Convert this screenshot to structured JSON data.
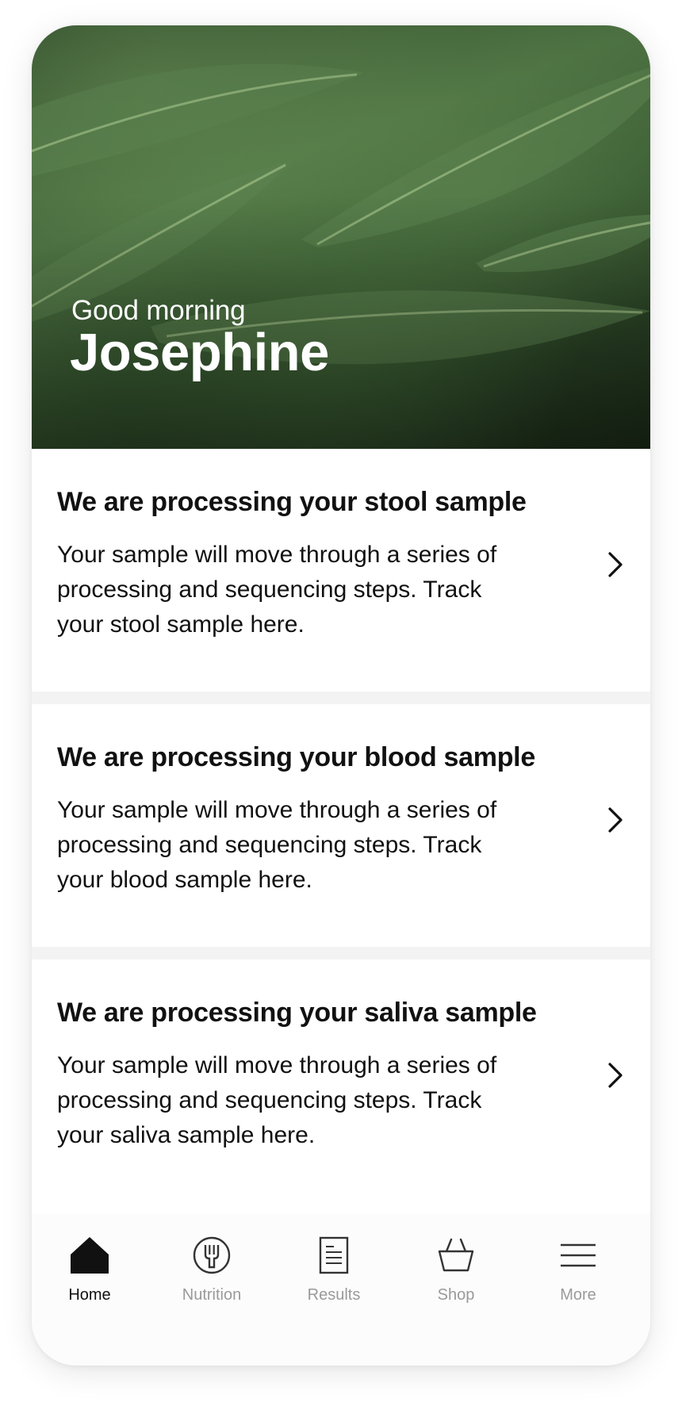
{
  "header": {
    "greeting": "Good morning",
    "user_name": "Josephine"
  },
  "cards": [
    {
      "title": "We are processing your stool sample",
      "body": "Your sample will move through a series of processing and sequencing steps. Track your stool sample here."
    },
    {
      "title": "We are processing your blood sample",
      "body": "Your sample will move through a series of processing and sequencing steps. Track your blood sample here."
    },
    {
      "title": "We are processing your saliva sample",
      "body": "Your sample will move through a series of processing and sequencing steps. Track your saliva sample here."
    }
  ],
  "tabbar": {
    "items": [
      {
        "label": "Home",
        "icon": "home-icon",
        "active": true
      },
      {
        "label": "Nutrition",
        "icon": "fork-icon",
        "active": false
      },
      {
        "label": "Results",
        "icon": "document-icon",
        "active": false
      },
      {
        "label": "Shop",
        "icon": "basket-icon",
        "active": false
      },
      {
        "label": "More",
        "icon": "menu-icon",
        "active": false
      }
    ]
  },
  "colors": {
    "text": "#111111",
    "inactive_tab": "#9a9a9a",
    "separator": "#f3f3f3",
    "hero_green": "#4e7443"
  }
}
